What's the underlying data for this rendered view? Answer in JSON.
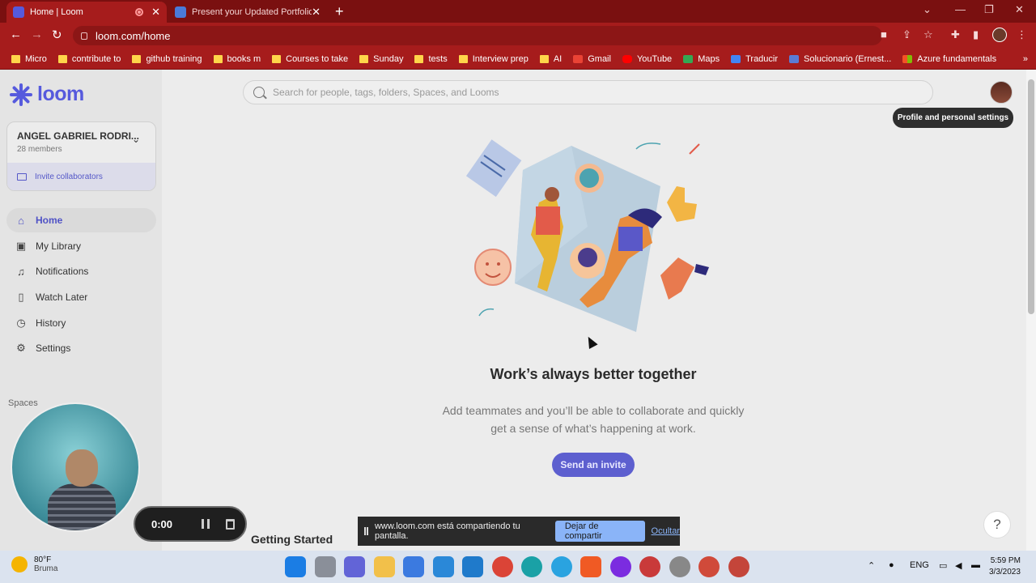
{
  "browser": {
    "tabs": [
      {
        "title": "Home | Loom",
        "active": true
      },
      {
        "title": "Present your Updated Portfolio",
        "active": false
      }
    ],
    "url": "loom.com/home",
    "bookmarks": [
      {
        "label": "Micro",
        "type": "folder"
      },
      {
        "label": "contribute to",
        "type": "folder"
      },
      {
        "label": "github training",
        "type": "folder"
      },
      {
        "label": "books m",
        "type": "folder"
      },
      {
        "label": "Courses to take",
        "type": "folder"
      },
      {
        "label": "Sunday",
        "type": "folder"
      },
      {
        "label": "tests",
        "type": "folder"
      },
      {
        "label": "Interview prep",
        "type": "folder"
      },
      {
        "label": "AI",
        "type": "folder"
      },
      {
        "label": "Gmail",
        "type": "gmail"
      },
      {
        "label": "YouTube",
        "type": "youtube"
      },
      {
        "label": "Maps",
        "type": "maps"
      },
      {
        "label": "Traducir",
        "type": "translate"
      },
      {
        "label": "Solucionario (Ernest...",
        "type": "doc"
      },
      {
        "label": "Azure fundamentals",
        "type": "ms"
      }
    ],
    "more_bookmarks": "»"
  },
  "sidebar": {
    "logo": "loom",
    "workspace": {
      "name": "ANGEL GABRIEL RODRI...",
      "members": "28 members"
    },
    "invite_label": "Invite collaborators",
    "nav": [
      {
        "label": "Home",
        "icon": "home-icon",
        "active": true
      },
      {
        "label": "My Library",
        "icon": "library-icon",
        "active": false
      },
      {
        "label": "Notifications",
        "icon": "bell-icon",
        "active": false
      },
      {
        "label": "Watch Later",
        "icon": "bookmark-icon",
        "active": false
      },
      {
        "label": "History",
        "icon": "clock-icon",
        "active": false
      },
      {
        "label": "Settings",
        "icon": "gear-icon",
        "active": false
      }
    ],
    "spaces_label": "Spaces"
  },
  "main": {
    "search_placeholder": "Search for people, tags, folders, Spaces, and Looms",
    "profile_tooltip": "Profile and personal settings",
    "hero_title": "Work’s always better together",
    "hero_sub_line1": "Add teammates and you’ll be able to collaborate and quickly",
    "hero_sub_line2": "get a sense of what’s happening at work.",
    "cta": "Send an invite",
    "section_title": "Getting Started",
    "help": "?"
  },
  "recorder": {
    "time": "0:00"
  },
  "share_bar": {
    "message": "www.loom.com está compartiendo tu pantalla.",
    "stop": "Dejar de compartir",
    "hide": "Ocultar"
  },
  "taskbar": {
    "temp": "80°F",
    "weather": "Bruma",
    "lang": "ENG",
    "time": "5:59 PM",
    "date": "3/3/2023"
  },
  "colors": {
    "brand": "#565add",
    "chrome": "#a61c1c",
    "cta": "#5d5fcf"
  }
}
